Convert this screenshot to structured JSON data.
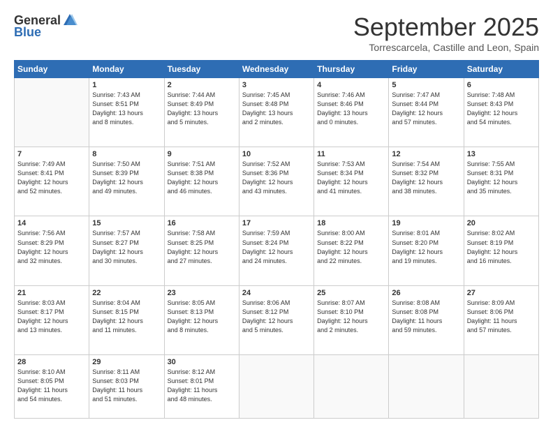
{
  "header": {
    "logo_general": "General",
    "logo_blue": "Blue",
    "month_title": "September 2025",
    "location": "Torrescarcela, Castille and Leon, Spain"
  },
  "weekdays": [
    "Sunday",
    "Monday",
    "Tuesday",
    "Wednesday",
    "Thursday",
    "Friday",
    "Saturday"
  ],
  "weeks": [
    [
      {
        "day": "",
        "info": ""
      },
      {
        "day": "1",
        "info": "Sunrise: 7:43 AM\nSunset: 8:51 PM\nDaylight: 13 hours\nand 8 minutes."
      },
      {
        "day": "2",
        "info": "Sunrise: 7:44 AM\nSunset: 8:49 PM\nDaylight: 13 hours\nand 5 minutes."
      },
      {
        "day": "3",
        "info": "Sunrise: 7:45 AM\nSunset: 8:48 PM\nDaylight: 13 hours\nand 2 minutes."
      },
      {
        "day": "4",
        "info": "Sunrise: 7:46 AM\nSunset: 8:46 PM\nDaylight: 13 hours\nand 0 minutes."
      },
      {
        "day": "5",
        "info": "Sunrise: 7:47 AM\nSunset: 8:44 PM\nDaylight: 12 hours\nand 57 minutes."
      },
      {
        "day": "6",
        "info": "Sunrise: 7:48 AM\nSunset: 8:43 PM\nDaylight: 12 hours\nand 54 minutes."
      }
    ],
    [
      {
        "day": "7",
        "info": "Sunrise: 7:49 AM\nSunset: 8:41 PM\nDaylight: 12 hours\nand 52 minutes."
      },
      {
        "day": "8",
        "info": "Sunrise: 7:50 AM\nSunset: 8:39 PM\nDaylight: 12 hours\nand 49 minutes."
      },
      {
        "day": "9",
        "info": "Sunrise: 7:51 AM\nSunset: 8:38 PM\nDaylight: 12 hours\nand 46 minutes."
      },
      {
        "day": "10",
        "info": "Sunrise: 7:52 AM\nSunset: 8:36 PM\nDaylight: 12 hours\nand 43 minutes."
      },
      {
        "day": "11",
        "info": "Sunrise: 7:53 AM\nSunset: 8:34 PM\nDaylight: 12 hours\nand 41 minutes."
      },
      {
        "day": "12",
        "info": "Sunrise: 7:54 AM\nSunset: 8:32 PM\nDaylight: 12 hours\nand 38 minutes."
      },
      {
        "day": "13",
        "info": "Sunrise: 7:55 AM\nSunset: 8:31 PM\nDaylight: 12 hours\nand 35 minutes."
      }
    ],
    [
      {
        "day": "14",
        "info": "Sunrise: 7:56 AM\nSunset: 8:29 PM\nDaylight: 12 hours\nand 32 minutes."
      },
      {
        "day": "15",
        "info": "Sunrise: 7:57 AM\nSunset: 8:27 PM\nDaylight: 12 hours\nand 30 minutes."
      },
      {
        "day": "16",
        "info": "Sunrise: 7:58 AM\nSunset: 8:25 PM\nDaylight: 12 hours\nand 27 minutes."
      },
      {
        "day": "17",
        "info": "Sunrise: 7:59 AM\nSunset: 8:24 PM\nDaylight: 12 hours\nand 24 minutes."
      },
      {
        "day": "18",
        "info": "Sunrise: 8:00 AM\nSunset: 8:22 PM\nDaylight: 12 hours\nand 22 minutes."
      },
      {
        "day": "19",
        "info": "Sunrise: 8:01 AM\nSunset: 8:20 PM\nDaylight: 12 hours\nand 19 minutes."
      },
      {
        "day": "20",
        "info": "Sunrise: 8:02 AM\nSunset: 8:19 PM\nDaylight: 12 hours\nand 16 minutes."
      }
    ],
    [
      {
        "day": "21",
        "info": "Sunrise: 8:03 AM\nSunset: 8:17 PM\nDaylight: 12 hours\nand 13 minutes."
      },
      {
        "day": "22",
        "info": "Sunrise: 8:04 AM\nSunset: 8:15 PM\nDaylight: 12 hours\nand 11 minutes."
      },
      {
        "day": "23",
        "info": "Sunrise: 8:05 AM\nSunset: 8:13 PM\nDaylight: 12 hours\nand 8 minutes."
      },
      {
        "day": "24",
        "info": "Sunrise: 8:06 AM\nSunset: 8:12 PM\nDaylight: 12 hours\nand 5 minutes."
      },
      {
        "day": "25",
        "info": "Sunrise: 8:07 AM\nSunset: 8:10 PM\nDaylight: 12 hours\nand 2 minutes."
      },
      {
        "day": "26",
        "info": "Sunrise: 8:08 AM\nSunset: 8:08 PM\nDaylight: 11 hours\nand 59 minutes."
      },
      {
        "day": "27",
        "info": "Sunrise: 8:09 AM\nSunset: 8:06 PM\nDaylight: 11 hours\nand 57 minutes."
      }
    ],
    [
      {
        "day": "28",
        "info": "Sunrise: 8:10 AM\nSunset: 8:05 PM\nDaylight: 11 hours\nand 54 minutes."
      },
      {
        "day": "29",
        "info": "Sunrise: 8:11 AM\nSunset: 8:03 PM\nDaylight: 11 hours\nand 51 minutes."
      },
      {
        "day": "30",
        "info": "Sunrise: 8:12 AM\nSunset: 8:01 PM\nDaylight: 11 hours\nand 48 minutes."
      },
      {
        "day": "",
        "info": ""
      },
      {
        "day": "",
        "info": ""
      },
      {
        "day": "",
        "info": ""
      },
      {
        "day": "",
        "info": ""
      }
    ]
  ]
}
